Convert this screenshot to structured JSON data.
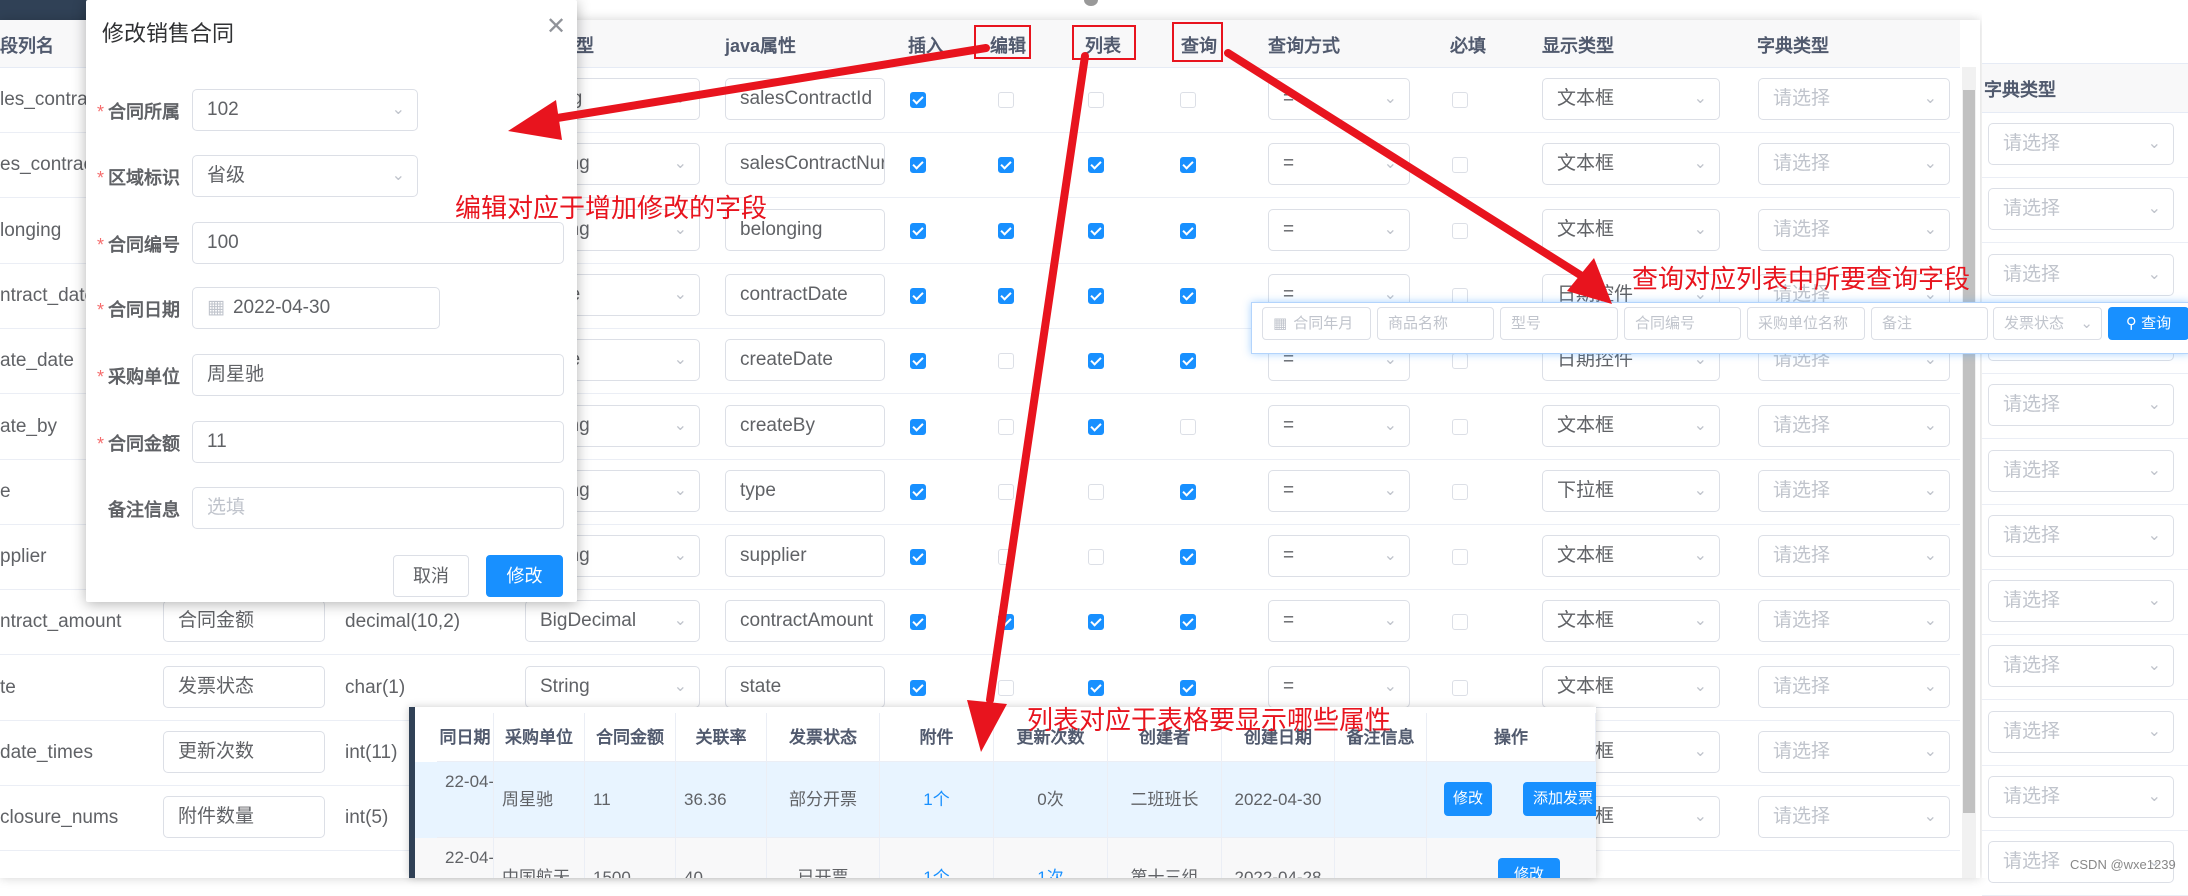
{
  "columns_table": {
    "headers": {
      "column_name": "段列名",
      "java_type": "型",
      "java_attr": "java属性",
      "insert": "插入",
      "edit": "编辑",
      "list": "列表",
      "query": "查询",
      "query_mode": "查询方式",
      "required": "必填",
      "display_type": "显示类型",
      "dict_type": "字典类型"
    },
    "rows": [
      {
        "column_name": "les_contract_",
        "description": "",
        "physical_type": "",
        "java_type": "Long",
        "java_attr": "salesContractId",
        "insert": true,
        "edit": false,
        "list": false,
        "query": false,
        "query_mode": "=",
        "required": false,
        "display_type": "文本框",
        "dict_type": "请选择"
      },
      {
        "column_name": "es_contract_",
        "description": "",
        "physical_type": "",
        "java_type": "String",
        "java_attr": "salesContractNur",
        "insert": true,
        "edit": true,
        "list": true,
        "query": true,
        "query_mode": "=",
        "required": false,
        "display_type": "文本框",
        "dict_type": "请选择"
      },
      {
        "column_name": "longing",
        "description": "",
        "physical_type": "",
        "java_type": "String",
        "java_attr": "belonging",
        "insert": true,
        "edit": true,
        "list": true,
        "query": true,
        "query_mode": "=",
        "required": false,
        "display_type": "文本框",
        "dict_type": "请选择"
      },
      {
        "column_name": "ntract_date",
        "description": "",
        "physical_type": "",
        "java_type": "Date",
        "java_attr": "contractDate",
        "insert": true,
        "edit": true,
        "list": true,
        "query": true,
        "query_mode": "=",
        "required": false,
        "display_type": "日期控件",
        "dict_type": "请选择"
      },
      {
        "column_name": "ate_date",
        "description": "",
        "physical_type": "",
        "java_type": "Date",
        "java_attr": "createDate",
        "insert": true,
        "edit": false,
        "list": true,
        "query": true,
        "query_mode": "=",
        "required": false,
        "display_type": "日期控件",
        "dict_type": "请选择"
      },
      {
        "column_name": "ate_by",
        "description": "",
        "physical_type": "",
        "java_type": "String",
        "java_attr": "createBy",
        "insert": true,
        "edit": false,
        "list": true,
        "query": false,
        "query_mode": "=",
        "required": false,
        "display_type": "文本框",
        "dict_type": "请选择"
      },
      {
        "column_name": "e",
        "description": "",
        "physical_type": "",
        "java_type": "String",
        "java_attr": "type",
        "insert": true,
        "edit": false,
        "list": false,
        "query": true,
        "query_mode": "=",
        "required": false,
        "display_type": "下拉框",
        "dict_type": "请选择"
      },
      {
        "column_name": "pplier",
        "description": "",
        "physical_type": "",
        "java_type": "String",
        "java_attr": "supplier",
        "insert": true,
        "edit": false,
        "list": false,
        "query": true,
        "query_mode": "=",
        "required": false,
        "display_type": "文本框",
        "dict_type": "请选择"
      },
      {
        "column_name": "ntract_amount",
        "description": "合同金额",
        "physical_type": "decimal(10,2)",
        "java_type": "BigDecimal",
        "java_attr": "contractAmount",
        "insert": true,
        "edit": true,
        "list": true,
        "query": true,
        "query_mode": "=",
        "required": false,
        "display_type": "文本框",
        "dict_type": "请选择"
      },
      {
        "column_name": "te",
        "description": "发票状态",
        "physical_type": "char(1)",
        "java_type": "String",
        "java_attr": "state",
        "insert": true,
        "edit": false,
        "list": true,
        "query": true,
        "query_mode": "=",
        "required": false,
        "display_type": "文本框",
        "dict_type": "请选择"
      },
      {
        "column_name": "date_times",
        "description": "更新次数",
        "physical_type": "int(11)",
        "java_type": "",
        "java_attr": "",
        "insert": true,
        "edit": false,
        "list": true,
        "query": true,
        "query_mode": "=",
        "required": false,
        "display_type": "文本框",
        "dict_type": "请选择"
      },
      {
        "column_name": "closure_nums",
        "description": "附件数量",
        "physical_type": "int(5)",
        "java_type": "",
        "java_attr": "",
        "insert": true,
        "edit": false,
        "list": true,
        "query": true,
        "query_mode": "=",
        "required": false,
        "display_type": "文本框",
        "dict_type": "请选择"
      }
    ]
  },
  "right_panel": {
    "header": "字典类型",
    "placeholder": "请选择",
    "count": 12
  },
  "dialog": {
    "title": "修改销售合同",
    "fields": [
      {
        "label": "合同所属",
        "required": true,
        "value": "102",
        "kind": "select"
      },
      {
        "label": "区域标识",
        "required": true,
        "value": "省级",
        "kind": "select"
      },
      {
        "label": "合同编号",
        "required": true,
        "value": "100",
        "kind": "input"
      },
      {
        "label": "合同日期",
        "required": true,
        "value": "2022-04-30",
        "kind": "date"
      },
      {
        "label": "采购单位",
        "required": true,
        "value": "周星驰",
        "kind": "input"
      },
      {
        "label": "合同金额",
        "required": true,
        "value": "11",
        "kind": "input"
      },
      {
        "label": "备注信息",
        "required": false,
        "value": "",
        "placeholder": "选填",
        "kind": "input"
      }
    ],
    "cancel_label": "取消",
    "submit_label": "修改"
  },
  "search_bar": {
    "fields": [
      "合同年月",
      "商品名称",
      "型号",
      "合同编号",
      "采购单位名称",
      "备注"
    ],
    "status_select": "发票状态",
    "search_label": "查询"
  },
  "list_table": {
    "headers": [
      "同日期",
      "采购单位",
      "合同金额",
      "关联率",
      "发票状态",
      "附件",
      "更新次数",
      "创建者",
      "创建日期",
      "备注信息",
      "操作"
    ],
    "rows": [
      {
        "cells": [
          "22-04-",
          "周星驰",
          "11",
          "36.36",
          "部分开票",
          "1个",
          "0次",
          "二班班长",
          "2022-04-30",
          ""
        ],
        "actions": [
          "修改",
          "添加发票"
        ]
      },
      {
        "cells": [
          "22-04-",
          "中国航天",
          "1500",
          "40",
          "已开票",
          "1个",
          "1次",
          "第十三组",
          "2022-04-28",
          ""
        ],
        "actions": [
          "修改"
        ]
      }
    ]
  },
  "annotations": {
    "edit_note": "编辑对应于增加修改的字段",
    "query_note": "查询对应列表中所要查询字段",
    "list_note": "列表对应于表格要显示哪些属性"
  },
  "watermark": "CSDN @wxe1239",
  "colors": {
    "primary": "#1890ff",
    "annotation": "#e8141e",
    "sidebar": "#304156"
  }
}
